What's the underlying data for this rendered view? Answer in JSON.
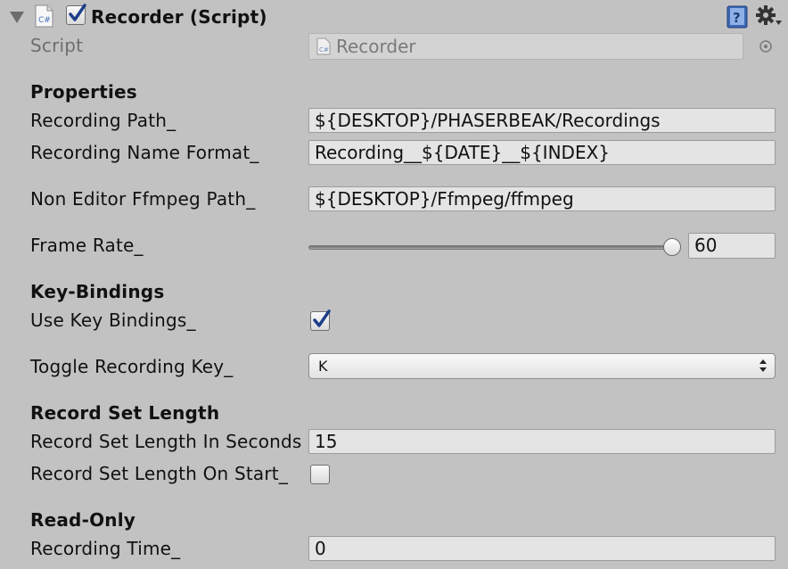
{
  "component": {
    "title": "Recorder (Script)",
    "enabled": true,
    "script_label": "Script",
    "script_value": "Recorder",
    "script_icon": "csharp-file-icon",
    "help_icon": "book-help-icon",
    "settings_icon": "gear-icon"
  },
  "sections": {
    "properties": "Properties",
    "key_bindings": "Key-Bindings",
    "record_set_length": "Record Set Length",
    "read_only": "Read-Only"
  },
  "fields": {
    "recording_path": {
      "label": "Recording Path_",
      "value": "${DESKTOP}/PHASERBEAK/Recordings"
    },
    "recording_name_format": {
      "label": "Recording Name Format_",
      "value": "Recording__${DATE}__${INDEX}"
    },
    "non_editor_ffmpeg_path": {
      "label": "Non Editor Ffmpeg Path_",
      "value": "${DESKTOP}/Ffmpeg/ffmpeg"
    },
    "frame_rate": {
      "label": "Frame Rate_",
      "value": "60",
      "slider_fraction": 1.0
    },
    "use_key_bindings": {
      "label": "Use Key Bindings_",
      "checked": true
    },
    "toggle_recording_key": {
      "label": "Toggle Recording Key_",
      "value": "K"
    },
    "record_set_length_seconds": {
      "label": "Record Set Length In Seconds",
      "value": "15"
    },
    "record_set_length_on_start": {
      "label": "Record Set Length On Start_",
      "checked": false
    },
    "recording_time": {
      "label": "Recording Time_",
      "value": "0"
    }
  },
  "colors": {
    "panel": "#c2c2c2",
    "field": "#e4e4e4",
    "check_blue": "#1e3f8a"
  }
}
